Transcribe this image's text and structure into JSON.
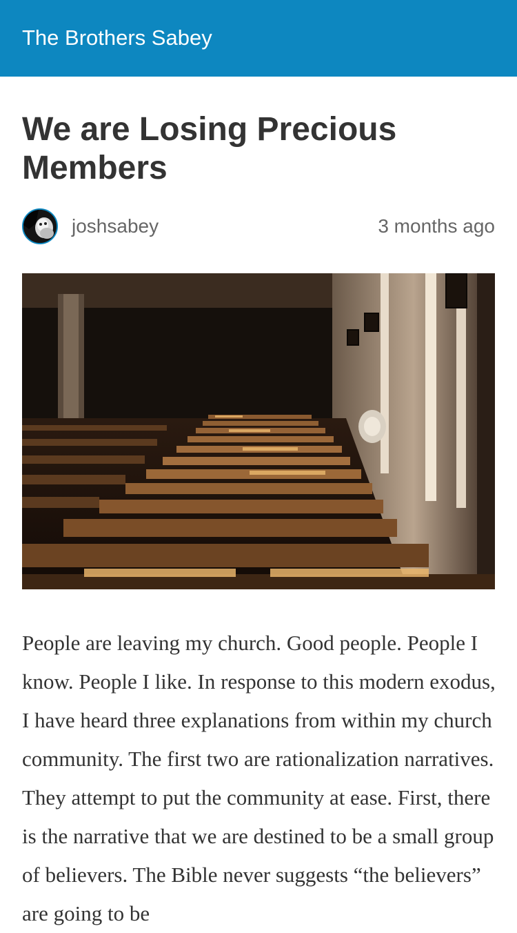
{
  "site": {
    "title": "The Brothers Sabey",
    "accent_color": "#0d87c0"
  },
  "post": {
    "title": "We are Losing Precious Members",
    "author": "joshsabey",
    "published": "3 months ago",
    "avatar_icon": "user-avatar",
    "hero_image": "church-pews-photo",
    "body": "People are leaving my church. Good people. People I know. People I like. In response to this modern exodus, I have heard three explanations from within my church community. The first two are rationalization narratives. They attempt to put the community at ease. First, there is the narrative that we are destined to be a small group of believers. The Bible never suggests “the believers” are going to be"
  }
}
